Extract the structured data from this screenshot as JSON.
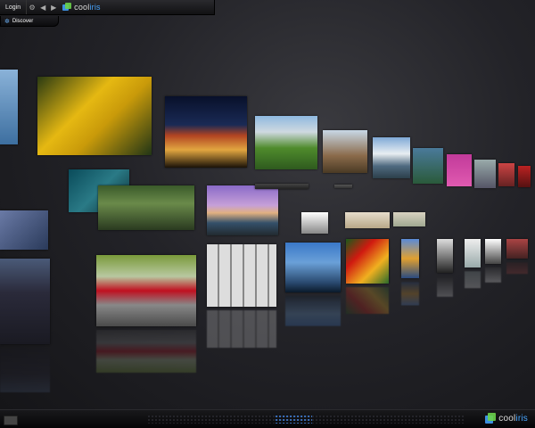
{
  "topbar": {
    "login_label": "Login",
    "settings_icon": "gear-icon",
    "back_icon": "back-arrow-icon",
    "forward_icon": "forward-arrow-icon",
    "brand_cool": "cool",
    "brand_iris": "iris"
  },
  "discover": {
    "label": "Discover",
    "icon": "discover-icon"
  },
  "footer": {
    "brand_cool": "cool",
    "brand_iris": "iris"
  },
  "colors": {
    "accent": "#3c8fe0",
    "accent2": "#6ad24a",
    "bg": "#1c1c20"
  }
}
